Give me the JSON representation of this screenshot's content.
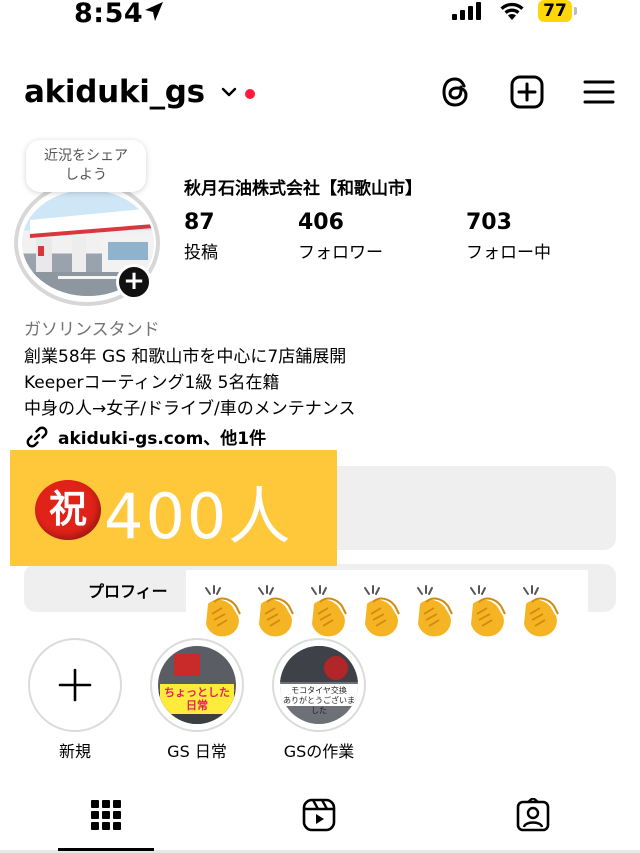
{
  "status_bar": {
    "time": "8:54",
    "battery": "77",
    "location_icon": "location-arrow-icon",
    "signal_icon": "cell-signal-icon",
    "wifi_icon": "wifi-icon"
  },
  "header": {
    "username": "akiduki_gs",
    "icons": [
      "threads-icon",
      "create-icon",
      "menu-icon"
    ]
  },
  "profile": {
    "note_bubble": "近況をシェア\nしよう",
    "display_name": "秋月石油株式会社【和歌山市】",
    "stats": [
      {
        "value": "87",
        "label": "投稿"
      },
      {
        "value": "406",
        "label": "フォロワー"
      },
      {
        "value": "703",
        "label": "フォロー中"
      }
    ],
    "category": "ガソリンスタンド",
    "bio": [
      "創業58年 GS 和歌山市を中心に7店舗展開",
      "Keeperコーティング1級 5名在籍",
      "中身の人→女子/ドライブ/車のメンテナンス"
    ],
    "link": "akiduki-gs.com、他1件"
  },
  "overlay": {
    "badge": "祝",
    "text": "400人",
    "claps": [
      "👏",
      "👏",
      "👏",
      "👏",
      "👏",
      "👏",
      "👏"
    ]
  },
  "buttons": {
    "profile_label": "プロフィー"
  },
  "highlights": [
    {
      "label": "新規"
    },
    {
      "label": "GS 日常",
      "cover_text": "ちょっとした日常"
    },
    {
      "label": "GSの作業",
      "cover_text": "モコタイヤ交換\nありがとうございました"
    }
  ],
  "tabs": [
    "grid-icon",
    "reels-icon",
    "tagged-icon"
  ]
}
